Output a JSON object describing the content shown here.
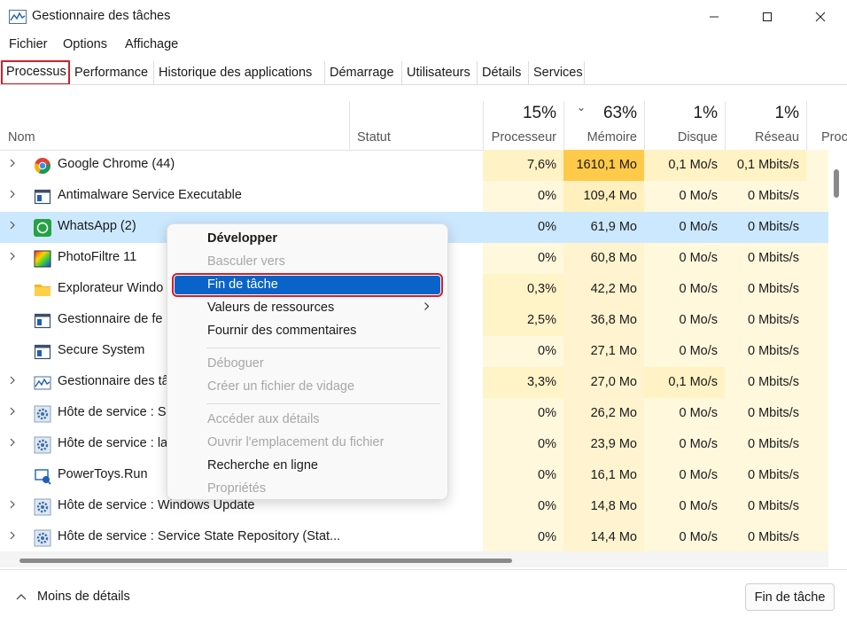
{
  "window": {
    "title": "Gestionnaire des tâches",
    "accent": "#0a63c9",
    "highlight_border": "#d0202a"
  },
  "menu": [
    "Fichier",
    "Options",
    "Affichage"
  ],
  "tabs": [
    "Processus",
    "Performance",
    "Historique des applications",
    "Démarrage",
    "Utilisateurs",
    "Détails",
    "Services"
  ],
  "header": {
    "name": "Nom",
    "status": "Statut",
    "cpu": {
      "pct": "15%",
      "label": "Processeur"
    },
    "memory": {
      "pct": "63%",
      "label": "Mémoire"
    },
    "disk": {
      "pct": "1%",
      "label": "Disque"
    },
    "network": {
      "pct": "1%",
      "label": "Réseau"
    },
    "extra": "Proc"
  },
  "rows": [
    {
      "name": "Google Chrome (44)",
      "icon": "chrome-icon",
      "expandable": true,
      "cpu": "7,6%",
      "mem": "1610,1 Mo",
      "disk": "0,1 Mo/s",
      "net": "0,1 Mbits/s"
    },
    {
      "name": "Antimalware Service Executable",
      "icon": "app-window-icon",
      "expandable": true,
      "cpu": "0%",
      "mem": "109,4 Mo",
      "disk": "0 Mo/s",
      "net": "0 Mbits/s"
    },
    {
      "name": "WhatsApp (2)",
      "icon": "whatsapp-icon",
      "expandable": true,
      "cpu": "0%",
      "mem": "61,9 Mo",
      "disk": "0 Mo/s",
      "net": "0 Mbits/s"
    },
    {
      "name": "PhotoFiltre 11",
      "icon": "photofiltre-icon",
      "expandable": true,
      "cpu": "0%",
      "mem": "60,8 Mo",
      "disk": "0 Mo/s",
      "net": "0 Mbits/s"
    },
    {
      "name": "Explorateur Windo",
      "icon": "folder-icon",
      "expandable": false,
      "cpu": "0,3%",
      "mem": "42,2 Mo",
      "disk": "0 Mo/s",
      "net": "0 Mbits/s"
    },
    {
      "name": "Gestionnaire de fe",
      "icon": "app-window-icon",
      "expandable": false,
      "cpu": "2,5%",
      "mem": "36,8 Mo",
      "disk": "0 Mo/s",
      "net": "0 Mbits/s"
    },
    {
      "name": "Secure System",
      "icon": "app-window-icon",
      "expandable": false,
      "cpu": "0%",
      "mem": "27,1 Mo",
      "disk": "0 Mo/s",
      "net": "0 Mbits/s"
    },
    {
      "name": "Gestionnaire des tâ",
      "icon": "task-manager-icon",
      "expandable": true,
      "cpu": "3,3%",
      "mem": "27,0 Mo",
      "disk": "0,1 Mo/s",
      "net": "0 Mbits/s"
    },
    {
      "name": "Hôte de service : S",
      "icon": "gear-icon",
      "expandable": true,
      "cpu": "0%",
      "mem": "26,2 Mo",
      "disk": "0 Mo/s",
      "net": "0 Mbits/s"
    },
    {
      "name": "Hôte de service : la",
      "icon": "gear-icon",
      "expandable": true,
      "cpu": "0%",
      "mem": "23,9 Mo",
      "disk": "0 Mo/s",
      "net": "0 Mbits/s"
    },
    {
      "name": "PowerToys.Run",
      "icon": "powertoys-icon",
      "expandable": false,
      "cpu": "0%",
      "mem": "16,1 Mo",
      "disk": "0 Mo/s",
      "net": "0 Mbits/s"
    },
    {
      "name": "Hôte de service : Windows Update",
      "icon": "gear-icon",
      "expandable": true,
      "cpu": "0%",
      "mem": "14,8 Mo",
      "disk": "0 Mo/s",
      "net": "0 Mbits/s"
    },
    {
      "name": "Hôte de service : Service State Repository (Stat...",
      "icon": "gear-icon",
      "expandable": true,
      "cpu": "0%",
      "mem": "14,4 Mo",
      "disk": "0 Mo/s",
      "net": "0 Mbits/s"
    }
  ],
  "context_menu": {
    "items": [
      {
        "label": "Développer",
        "bold": true
      },
      {
        "label": "Basculer vers",
        "disabled": true
      },
      {
        "label": "Fin de tâche",
        "highlighted": true
      },
      {
        "label": "Valeurs de ressources",
        "submenu": true
      },
      {
        "label": "Fournir des commentaires"
      },
      {
        "separator": true
      },
      {
        "label": "Déboguer",
        "disabled": true
      },
      {
        "label": "Créer un fichier de vidage",
        "disabled": true
      },
      {
        "separator": true
      },
      {
        "label": "Accéder aux détails",
        "disabled": true
      },
      {
        "label": "Ouvrir l'emplacement du fichier",
        "disabled": true
      },
      {
        "label": "Recherche en ligne"
      },
      {
        "label": "Propriétés",
        "disabled": true
      }
    ]
  },
  "footer": {
    "fewer_details": "Moins de détails",
    "end_task": "Fin de tâche"
  }
}
